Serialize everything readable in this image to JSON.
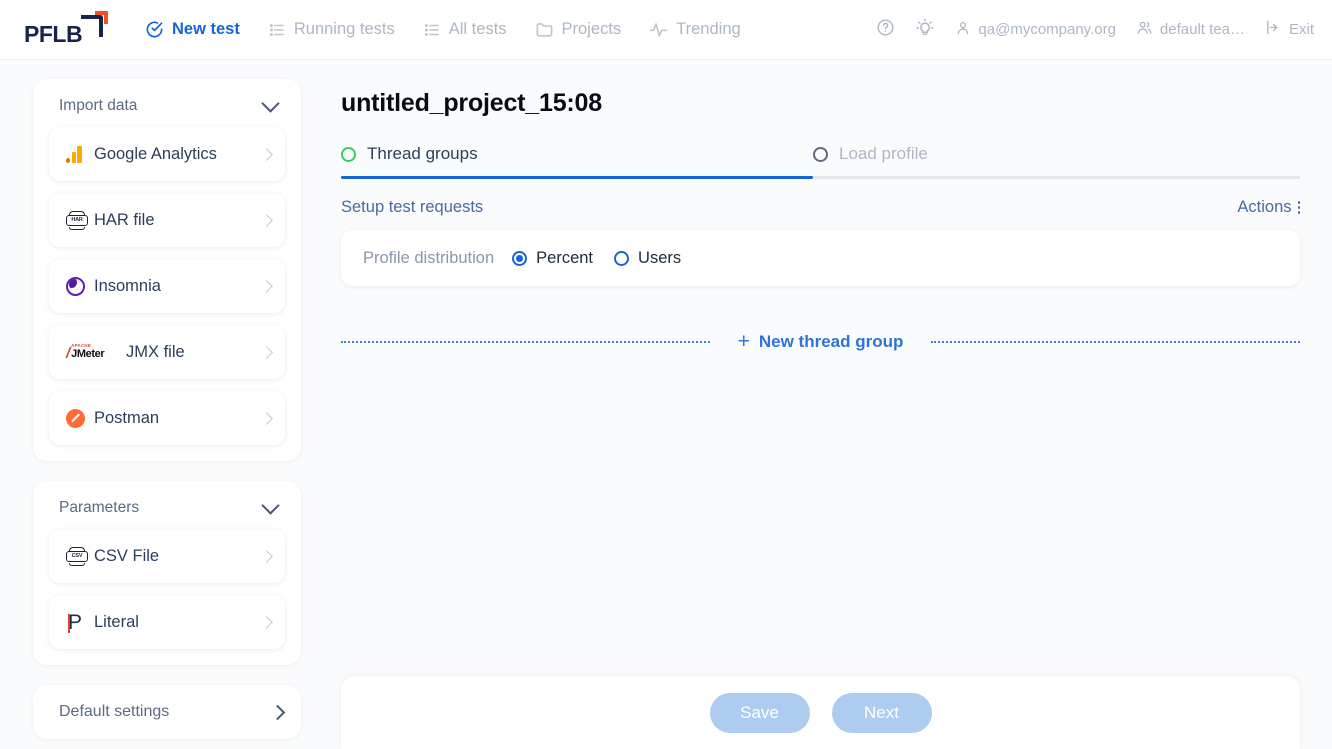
{
  "header": {
    "logo_text": "PFLB",
    "nav": [
      {
        "label": "New test",
        "icon": "check-circle-icon",
        "active": true
      },
      {
        "label": "Running tests",
        "icon": "list-icon",
        "active": false
      },
      {
        "label": "All tests",
        "icon": "list-icon",
        "active": false
      },
      {
        "label": "Projects",
        "icon": "folder-icon",
        "active": false
      },
      {
        "label": "Trending",
        "icon": "activity-icon",
        "active": false
      }
    ],
    "help_icon": "question-circle-icon",
    "tips_icon": "lightbulb-icon",
    "user": "qa@mycompany.org",
    "team": "default tea…",
    "exit": "Exit"
  },
  "sidebar": {
    "import": {
      "title": "Import data",
      "items": [
        {
          "label": "Google Analytics",
          "icon": "google-analytics-icon"
        },
        {
          "label": "HAR file",
          "icon": "har-file-icon",
          "badge": "HAR"
        },
        {
          "label": "Insomnia",
          "icon": "insomnia-icon"
        },
        {
          "label": "JMX file",
          "icon": "jmeter-icon",
          "brand_top": "APACHE",
          "brand_main": "JMeter"
        },
        {
          "label": "Postman",
          "icon": "postman-icon"
        }
      ]
    },
    "parameters": {
      "title": "Parameters",
      "items": [
        {
          "label": "CSV File",
          "icon": "csv-file-icon",
          "badge": "CSV"
        },
        {
          "label": "Literal",
          "icon": "literal-p-icon",
          "glyph": "P"
        }
      ]
    },
    "default_settings": {
      "label": "Default settings",
      "icon": "chevron-right-icon"
    }
  },
  "main": {
    "project_title": "untitled_project_15:08",
    "tabs": [
      {
        "label": "Thread groups",
        "active": true
      },
      {
        "label": "Load profile",
        "active": false
      }
    ],
    "section_title": "Setup test requests",
    "actions_label": "Actions",
    "distribution": {
      "label": "Profile distribution",
      "options": [
        {
          "label": "Percent",
          "selected": true
        },
        {
          "label": "Users",
          "selected": false
        }
      ]
    },
    "new_thread_group": {
      "plus": "+",
      "label": "New thread group"
    }
  },
  "footer": {
    "save_label": "Save",
    "next_label": "Next"
  },
  "colors": {
    "accent_blue": "#1565d8",
    "link_blue": "#2f73d9",
    "green_dot": "#3dc96a",
    "disabled_button": "#aecbf0",
    "muted_text": "#aeb7c4"
  }
}
